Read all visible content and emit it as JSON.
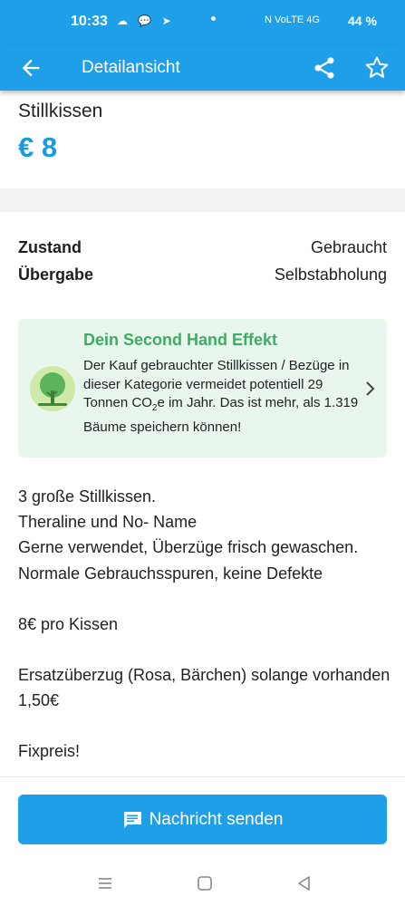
{
  "status": {
    "time": "10:33",
    "left_icons": "☁ 💬 ➤",
    "right_icons": "N  VoLTE  4G",
    "battery": "44 %"
  },
  "app_bar": {
    "title": "Detailansicht",
    "icons": [
      "arrow-left-icon",
      "share-icon",
      "star-outline-icon"
    ]
  },
  "item": {
    "title": "Stillkissen",
    "price": "€ 8"
  },
  "details": [
    {
      "label": "Zustand",
      "value": "Gebraucht"
    },
    {
      "label": "Übergabe",
      "value": "Selbstabholung"
    }
  ],
  "effect": {
    "title": "Dein Second Hand Effekt",
    "text_before": "Der Kauf gebrauchter Stillkissen / Bezüge in dieser Kategorie vermeidet potentiell 29 Tonnen CO",
    "subscript": "2",
    "text_after": "e im Jahr. Das ist mehr, als 1.319 Bäume speichern können!"
  },
  "description": [
    "3 große Stillkissen.\nTheraline und No- Name\nGerne verwendet, Überzüge frisch gewaschen.\nNormale Gebrauchsspuren, keine Defekte",
    "8€ pro Kissen",
    "Ersatzüberzug (Rosa, Bärchen) solange vorhanden 1,50€",
    "Fixpreis!"
  ],
  "cta": {
    "label": "Nachricht senden"
  },
  "colors": {
    "brand": "#1f9fe8",
    "price": "#1a9be0",
    "effect_bg": "#e9f6ee",
    "effect_title": "#3bae62"
  }
}
